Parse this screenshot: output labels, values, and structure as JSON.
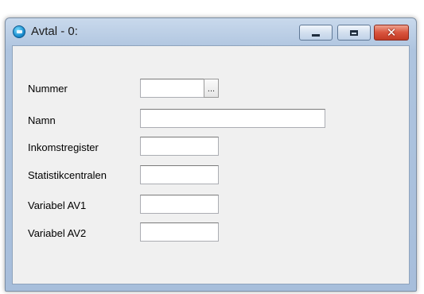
{
  "window": {
    "title": "Avtal - 0:",
    "close_symbol": "✕"
  },
  "form": {
    "fields": [
      {
        "label": "Nummer",
        "value": ""
      },
      {
        "label": "Namn",
        "value": ""
      },
      {
        "label": "Inkomstregister",
        "value": ""
      },
      {
        "label": "Statistikcentralen",
        "value": ""
      },
      {
        "label": "Variabel AV1",
        "value": ""
      },
      {
        "label": "Variabel AV2",
        "value": ""
      }
    ],
    "browse_label": "..."
  },
  "icons": {
    "app": "app-icon",
    "minimize": "minimize-icon",
    "maximize": "maximize-icon",
    "close": "close-icon"
  }
}
